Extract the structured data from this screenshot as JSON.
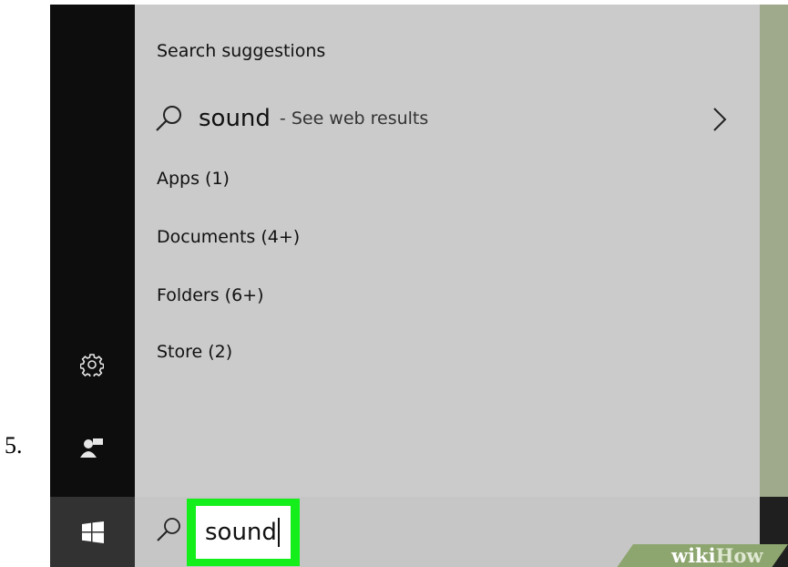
{
  "step": {
    "number": "5."
  },
  "rail": {
    "icons": [
      "gear-icon",
      "user-icon",
      "windows-start-icon"
    ]
  },
  "panel": {
    "section_title": "Search suggestions",
    "suggestion": {
      "query": "sound",
      "sub": "- See web results"
    },
    "categories": [
      {
        "label": "Apps (1)"
      },
      {
        "label": "Documents (4+)"
      },
      {
        "label": "Folders (6+)"
      },
      {
        "label": "Store (2)"
      }
    ]
  },
  "search": {
    "value": "sound",
    "highlight_color": "#14ee1a"
  },
  "watermark": {
    "part1": "wiki",
    "part2": "How"
  },
  "colors": {
    "rail": "#0d0d0d",
    "panel": "#cbcbcb",
    "accent_strip": "#9fa98c"
  }
}
